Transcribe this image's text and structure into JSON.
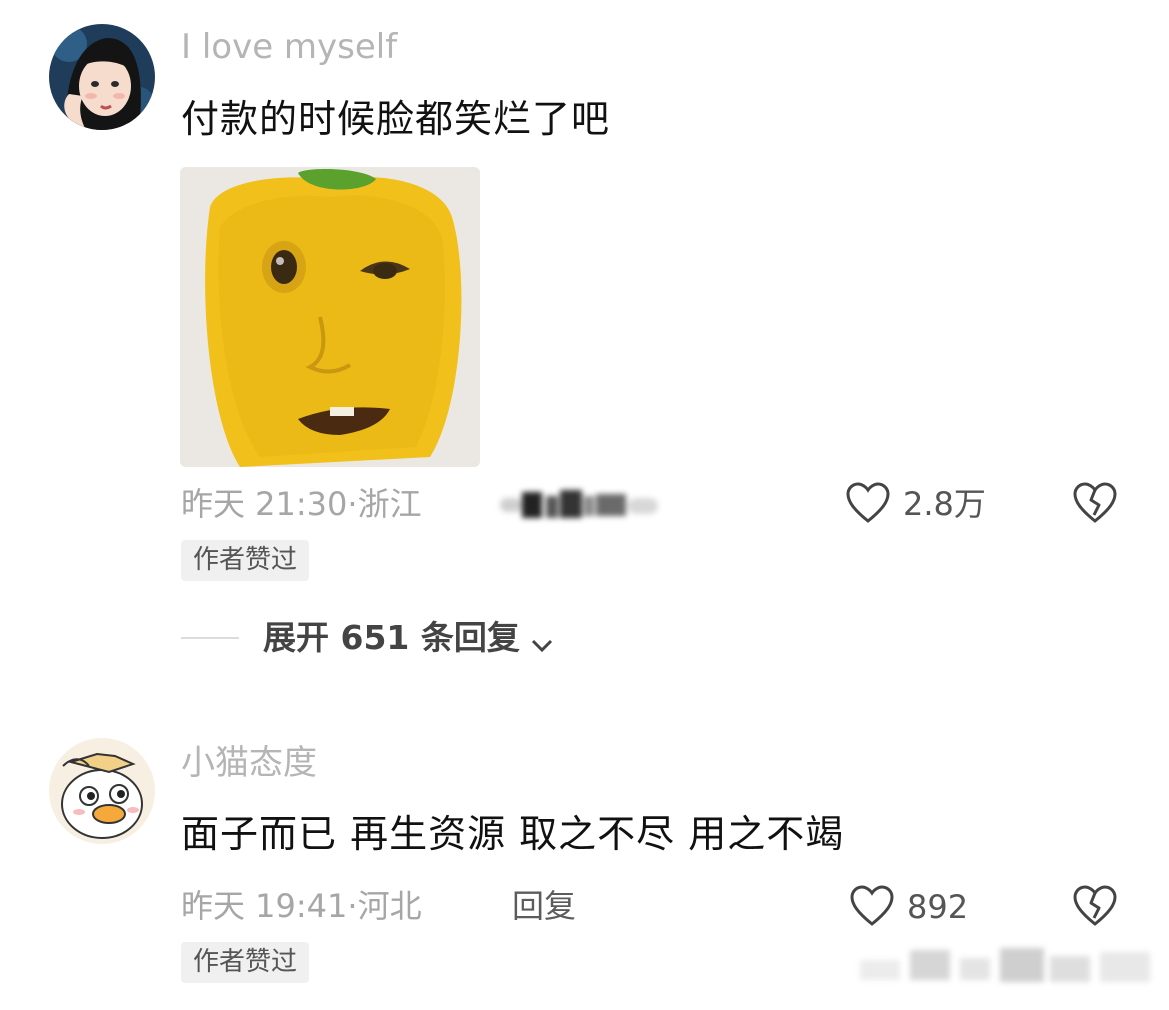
{
  "comments": [
    {
      "username": "I love myself",
      "text": "付款的时候脸都笑烂了吧",
      "time": "昨天 21:30",
      "location": "浙江",
      "likes": "2.8万",
      "badge": "作者赞过",
      "expand_replies": "展开 651 条回复",
      "avatar_icon": "user-avatar-illustrated-girl",
      "image": "yellow-pepper-face-meme"
    },
    {
      "username": "小猫态度",
      "text": "面子而已 再生资源 取之不尽 用之不竭",
      "time": "昨天 19:41",
      "location": "河北",
      "reply_label": "回复",
      "likes": "892",
      "badge": "作者赞过",
      "avatar_icon": "user-avatar-cartoon-duck"
    }
  ],
  "icons": {
    "like": "heart-outline-icon",
    "dislike": "broken-heart-icon",
    "expand": "chevron-down-icon"
  },
  "colors": {
    "username": "#b5b5b5",
    "meta": "#a6a6a6",
    "badge_bg": "#f0f0f0",
    "pepper": "#f2c21b"
  }
}
